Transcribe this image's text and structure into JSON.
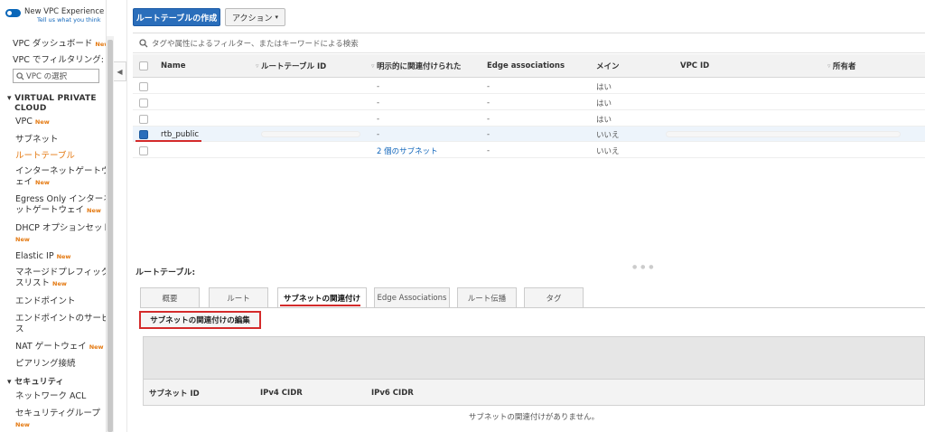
{
  "sidebar": {
    "vpc_experience": "New VPC Experience",
    "tell_us": "Tell us what you think",
    "dashboard": "VPC ダッシュボード",
    "new_badge": "New",
    "filter_by": "VPC でフィルタリング:",
    "select_vpc": "VPC の選択",
    "section_vpc": "VIRTUAL PRIVATE CLOUD",
    "section_security": "セキュリティ",
    "items": [
      {
        "label": "VPC",
        "new": true
      },
      {
        "label": "サブネット",
        "new": false
      },
      {
        "label": "ルートテーブル",
        "new": false
      },
      {
        "label": "インターネットゲートウ",
        "label2": "ェイ",
        "new": true
      },
      {
        "label": "Egress Only インターネ",
        "label2": "ットゲートウェイ",
        "new": true
      },
      {
        "label": "DHCP オプションセット",
        "new": true
      },
      {
        "label": "Elastic IP",
        "new": true
      },
      {
        "label": "マネージドプレフィック",
        "label2": "スリスト",
        "new": true
      },
      {
        "label": "エンドポイント",
        "new": false
      },
      {
        "label": "エンドポイントのサービ",
        "label2": "ス",
        "new": false
      },
      {
        "label": "NAT ゲートウェイ",
        "new": true
      },
      {
        "label": "ピアリング接続",
        "new": false
      }
    ],
    "security_items": [
      {
        "label": "ネットワーク ACL",
        "new": false
      },
      {
        "label": "セキュリティグループ",
        "new": true
      }
    ]
  },
  "toolbar": {
    "create_route_table": "ルートテーブルの作成",
    "actions": "アクション"
  },
  "table": {
    "filter_placeholder": "タグや属性によるフィルター、またはキーワードによる検索",
    "columns": [
      "Name",
      "ルートテーブル ID",
      "明示的に関連付けられた",
      "Edge associations",
      "メイン",
      "VPC ID",
      "所有者"
    ],
    "rows": [
      {
        "name": "",
        "explicit": "-",
        "edge": "-",
        "main": "はい",
        "selected": false
      },
      {
        "name": "",
        "explicit": "-",
        "edge": "-",
        "main": "はい",
        "selected": false
      },
      {
        "name": "",
        "explicit": "-",
        "edge": "-",
        "main": "はい",
        "selected": false
      },
      {
        "name": "rtb_public",
        "explicit": "-",
        "edge": "-",
        "main": "いいえ",
        "selected": true
      },
      {
        "name": "",
        "explicit": "2 個のサブネット",
        "edge": "-",
        "main": "いいえ",
        "selected": false
      }
    ]
  },
  "details": {
    "panel_label": "ルートテーブル:",
    "tabs": [
      "概要",
      "ルート",
      "サブネットの関連付け",
      "Edge Associations",
      "ルート伝播",
      "タグ"
    ],
    "active_tab": "サブネットの関連付け",
    "edit_button": "サブネットの関連付けの編集",
    "subnet_columns": [
      "サブネット ID",
      "IPv4 CIDR",
      "IPv6 CIDR"
    ],
    "empty_message": "サブネットの関連付けがありません。"
  },
  "colors": {
    "primary_button": "#2a6ebb",
    "accent_orange": "#e47911",
    "highlight_red": "#d42b2b",
    "link_blue": "#1166bb"
  }
}
